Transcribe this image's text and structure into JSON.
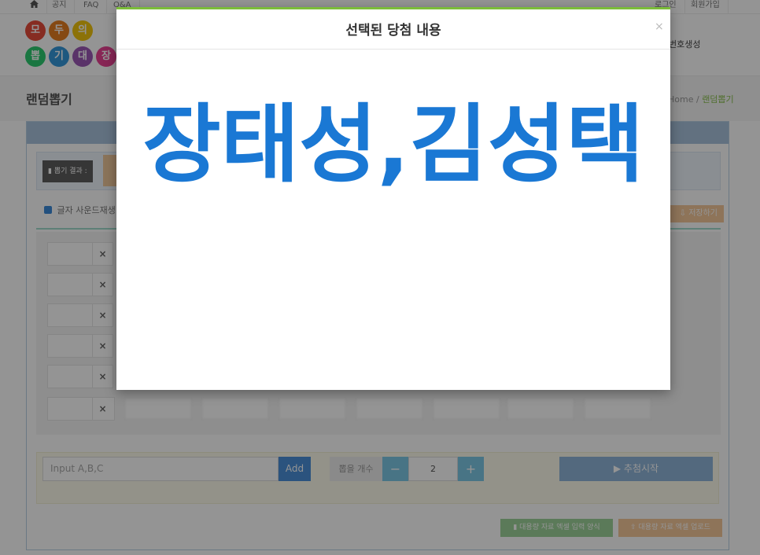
{
  "topbar": {
    "home_icon": "home-icon",
    "links": [
      "공지",
      "FAQ",
      "Q&A"
    ],
    "login": "로그인",
    "signup": "회원가입"
  },
  "header": {
    "logo_chars": [
      "모",
      "두",
      "의",
      "뽑",
      "기",
      "대",
      "장"
    ],
    "logo_colors": [
      "#e74c3c",
      "#e67e22",
      "#f1c40f",
      "#2ecc71",
      "#3498db",
      "#9b59b6",
      "#e84393"
    ],
    "nav_right": "번호생성"
  },
  "page": {
    "title": "랜덤뽑기",
    "breadcrumb_home": "Home",
    "breadcrumb_current": "랜덤뽑기"
  },
  "panel": {
    "result_label": "뽑기 결과 :",
    "sound_label": "글자 사운드재생",
    "save_label": "저장하기",
    "remove_glyph": "×",
    "input_placeholder": "Input A,B,C",
    "add_label": "Add",
    "count_label": "뽑을 개수",
    "count_value": "2",
    "minus_glyph": "−",
    "plus_glyph": "+",
    "start_label": "▶  추첨시작",
    "excel_form_label": "대용량 자료 엑셀 입력 양식",
    "excel_upload_label": "대용량 자료 엑셀 업로드"
  },
  "modal": {
    "title": "선택된 당첨 내용",
    "close_glyph": "×",
    "result_text": "장태성,김성택"
  },
  "colors": {
    "accent_blue": "#1a78d4",
    "modal_border": "#7cbd3a",
    "start_button": "#8fb5d9",
    "add_button": "#4a90d9"
  }
}
